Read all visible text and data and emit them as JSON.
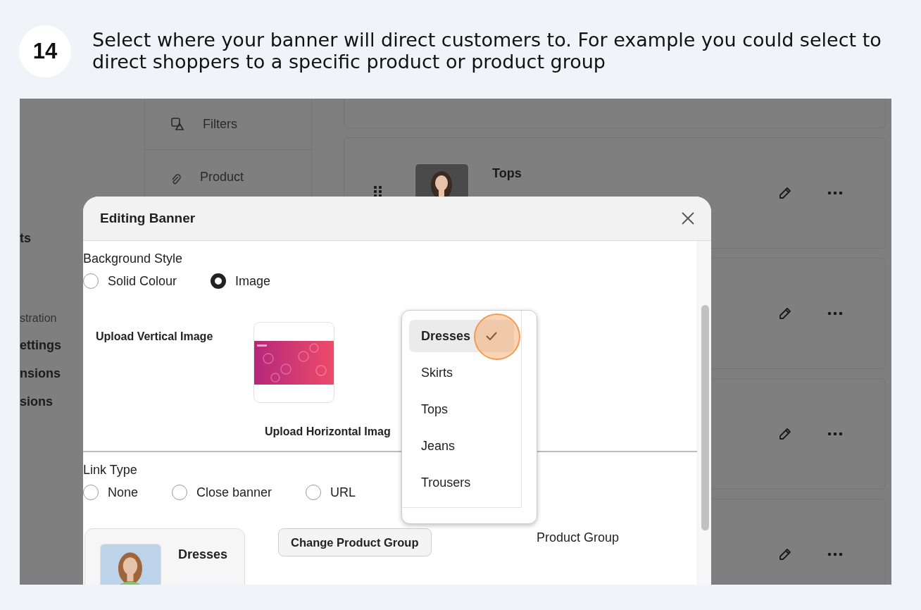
{
  "step": {
    "number": "14",
    "instruction": "Select where your banner will direct customers to. For example you could select to direct shoppers to a specific product or product group"
  },
  "background_app": {
    "sidebar_items": [
      {
        "kind": "link",
        "label": "ts"
      },
      {
        "kind": "heading",
        "label": "stration"
      },
      {
        "kind": "link",
        "label": "ettings"
      },
      {
        "kind": "link",
        "label": "nsions"
      },
      {
        "kind": "link",
        "label": "sions"
      }
    ],
    "nav_items": [
      {
        "kind": "filters",
        "label": "Filters"
      },
      {
        "kind": "link",
        "label": "Product"
      }
    ],
    "cards": [
      {
        "kind": "partial"
      },
      {
        "kind": "item",
        "title": "Tops"
      },
      {
        "kind": "actions"
      },
      {
        "kind": "actions"
      },
      {
        "kind": "actions"
      }
    ]
  },
  "modal": {
    "title": "Editing Banner",
    "background_style": {
      "label": "Background Style",
      "options": [
        {
          "label": "Solid Colour",
          "selected": false
        },
        {
          "label": "Image",
          "selected": true
        }
      ]
    },
    "upload_vertical_label": "Upload Vertical Image",
    "upload_horizontal_label": "Upload Horizontal Imag",
    "link_type": {
      "label": "Link Type",
      "options": [
        {
          "label": "None",
          "selected": false
        },
        {
          "label": "Close banner",
          "selected": false
        },
        {
          "label": "URL",
          "selected": false
        }
      ],
      "partial_option_label": "Product Group"
    },
    "product_group": {
      "name": "Dresses"
    },
    "change_button": "Change Product Group",
    "dropdown": {
      "items": [
        {
          "label": "Dresses",
          "selected": true
        },
        {
          "label": "Skirts",
          "selected": false
        },
        {
          "label": "Tops",
          "selected": false
        },
        {
          "label": "Jeans",
          "selected": false
        },
        {
          "label": "Trousers",
          "selected": false
        }
      ]
    }
  }
}
